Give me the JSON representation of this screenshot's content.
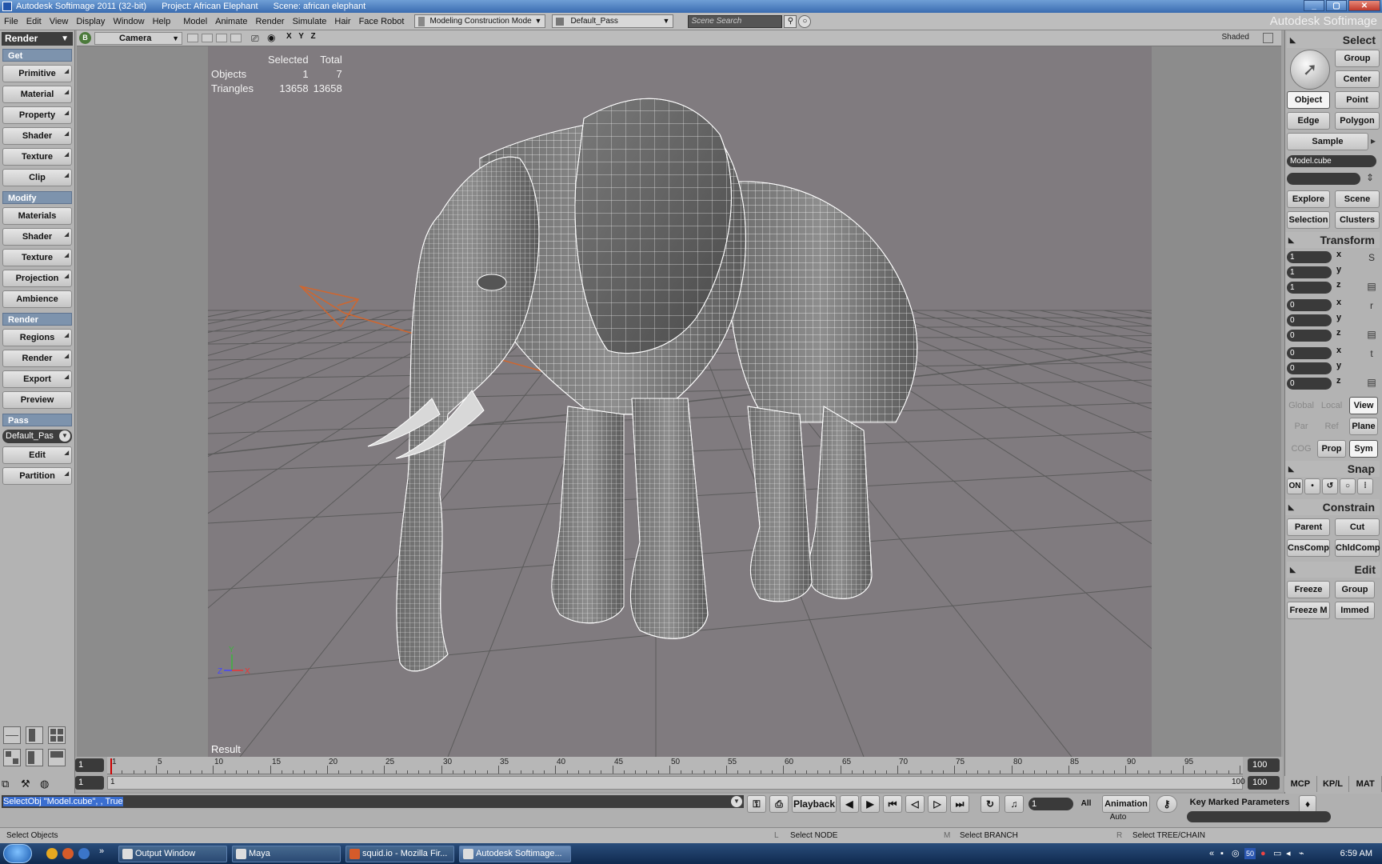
{
  "window": {
    "title": "Autodesk Softimage 2011 (32-bit)",
    "project": "Project: African Elephant",
    "scene": "Scene: african elephant",
    "brand": "Autodesk Softimage"
  },
  "menubar": {
    "menus": [
      "File",
      "Edit",
      "View",
      "Display",
      "Window",
      "Help",
      "Model",
      "Animate",
      "Render",
      "Simulate",
      "Hair",
      "Face Robot"
    ],
    "mode": "Modeling Construction Mode",
    "pass": "Default_Pass",
    "search_placeholder": "Scene Search"
  },
  "left": {
    "module": "Render",
    "get_label": "Get",
    "get_items": [
      "Primitive",
      "Material",
      "Property",
      "Shader",
      "Texture",
      "Clip"
    ],
    "modify_label": "Modify",
    "modify_items": [
      "Materials",
      "Shader",
      "Texture",
      "Projection",
      "Ambience"
    ],
    "render_label": "Render",
    "render_items": [
      "Regions",
      "Render",
      "Export",
      "Preview"
    ],
    "pass_label": "Pass",
    "pass_value": "Default_Pas",
    "pass_items": [
      "Edit",
      "Partition"
    ]
  },
  "viewport": {
    "badge": "B",
    "camera": "Camera",
    "axes": "X Y Z",
    "display_mode": "Shaded",
    "stats": {
      "col_selected": "Selected",
      "col_total": "Total",
      "rows": [
        {
          "label": "Objects",
          "selected": "1",
          "total": "7"
        },
        {
          "label": "Triangles",
          "selected": "13658",
          "total": "13658"
        }
      ]
    },
    "result_label": "Result"
  },
  "right": {
    "select_title": "Select",
    "btn_group": "Group",
    "btn_center": "Center",
    "btn_object": "Object",
    "btn_point": "Point",
    "btn_edge": "Edge",
    "btn_polygon": "Polygon",
    "btn_sample": "Sample",
    "selection_field": "Model.cube",
    "btn_explore": "Explore",
    "btn_scene": "Scene",
    "btn_selection": "Selection",
    "btn_clusters": "Clusters",
    "transform_title": "Transform",
    "scale": [
      "1",
      "1",
      "1"
    ],
    "rotate": [
      "0",
      "0",
      "0"
    ],
    "translate": [
      "0",
      "0",
      "0"
    ],
    "axis_x": "x",
    "axis_y": "y",
    "axis_z": "z",
    "btn_global": "Global",
    "btn_local": "Local",
    "btn_view": "View",
    "btn_par": "Par",
    "btn_ref": "Ref",
    "btn_plane": "Plane",
    "btn_cog": "COG",
    "btn_prop": "Prop",
    "btn_sym": "Sym",
    "snap_title": "Snap",
    "snap_on": "ON",
    "constrain_title": "Constrain",
    "btn_parent": "Parent",
    "btn_cut": "Cut",
    "btn_cnscomp": "CnsComp",
    "btn_chldcomp": "ChldComp",
    "edit_title": "Edit",
    "btn_freeze": "Freeze",
    "btn_group2": "Group",
    "btn_freezem": "Freeze M",
    "btn_immed": "Immed"
  },
  "timeline": {
    "start": "1",
    "range_start": "1",
    "end": "100",
    "range_end": "100",
    "range_label_start": "1",
    "range_label_end": "100",
    "playhead_frame": 1,
    "ticks": [
      "1",
      "5",
      "10",
      "15",
      "20",
      "25",
      "30",
      "35",
      "40",
      "45",
      "50",
      "55",
      "60",
      "65",
      "70",
      "75",
      "80",
      "85",
      "90",
      "95"
    ],
    "tabs": [
      "MCP",
      "KP/L",
      "MAT"
    ]
  },
  "command": {
    "text": "SelectObj \"Model.cube\", , True",
    "playback": "Playback",
    "frame": "1",
    "all": "All",
    "animation": "Animation",
    "auto": "Auto",
    "key_marked": "Key Marked Parameters"
  },
  "status": {
    "message": "Select Objects",
    "left_mouse": "Select NODE",
    "middle_mouse": "Select BRANCH",
    "right_mouse": "Select TREE/CHAIN",
    "l": "L",
    "m": "M",
    "r": "R"
  },
  "taskbar": {
    "tasks": [
      "Output Window",
      "Maya",
      "squid.io - Mozilla Fir...",
      "Autodesk Softimage..."
    ],
    "tray_number": "50",
    "clock": "6:59 AM"
  },
  "colors": {
    "section_blue": "#7d93ad",
    "viewport_bg": "#807b7f",
    "camera_orange": "#d0662e",
    "mesh_wire": "#ffffff"
  }
}
